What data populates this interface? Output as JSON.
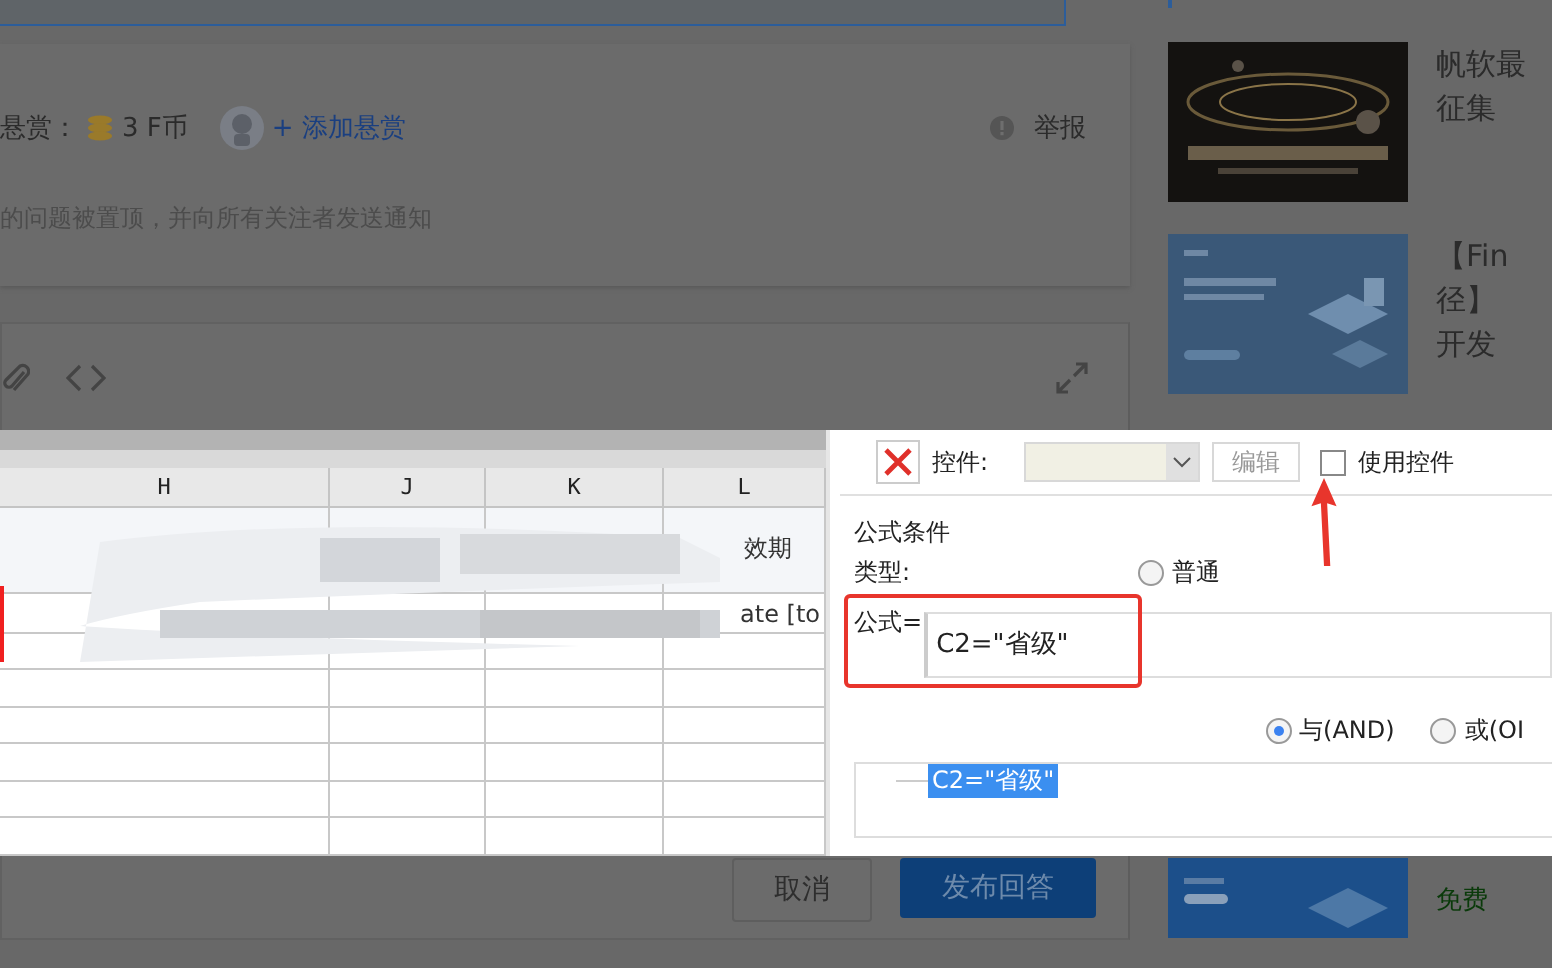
{
  "question_card": {
    "bounty_label": "悬赏：",
    "bounty_amount": "3 F币",
    "add_bounty": "+ 添加悬赏",
    "report": "举报",
    "notice": "的问题被置顶，并向所有关注者发送通知"
  },
  "answer_editor": {
    "cancel": "取消",
    "publish": "发布回答"
  },
  "sidebar": {
    "items": [
      {
        "kind": "picture",
        "title_lines": [
          "帆软最",
          "征集"
        ]
      },
      {
        "kind": "picture",
        "title_lines": [
          "【Fin",
          "径】",
          "开发"
        ]
      },
      {
        "kind": "picture",
        "tag": "免费"
      }
    ]
  },
  "spreadsheet": {
    "columns": [
      "H",
      "J",
      "K",
      "L"
    ],
    "last_column_texts": [
      "效期",
      "ate [to"
    ]
  },
  "condition_dialog": {
    "widget_label": "控件:",
    "edit_button": "编辑",
    "use_widget": {
      "label": "使用控件",
      "checked": false
    },
    "group_title": "公式条件",
    "type_label": "类型:",
    "type_options": [
      {
        "label": "普通",
        "selected": false
      }
    ],
    "formula_label": "公式=",
    "formula_value": "C2=\"省级\"",
    "logic_options": [
      {
        "label": "与(AND)",
        "selected": true
      },
      {
        "label": "或(OI",
        "selected": false
      }
    ],
    "conditions": [
      {
        "text": "C2=\"省级\"",
        "selected": true
      }
    ]
  }
}
